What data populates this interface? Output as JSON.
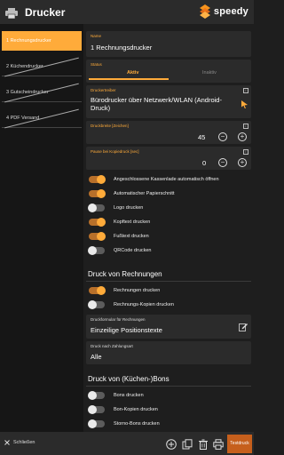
{
  "header": {
    "title": "Drucker",
    "brand": "speedy"
  },
  "sidebar": {
    "items": [
      {
        "label": "1 Rechnungsdrucker"
      },
      {
        "label": "2 Küchendrucker"
      },
      {
        "label": "3 Gutscheindrucker"
      },
      {
        "label": "4 PDF Versand"
      }
    ]
  },
  "form": {
    "name": {
      "label": "Name",
      "value": "1 Rechnungsdrucker"
    },
    "status": {
      "label": "Status",
      "active": "Aktiv",
      "inactive": "Inaktiv"
    },
    "driver": {
      "label": "Druckertreiber",
      "value": "Bürodrucker über Netzwerk/WLAN (Android-Druck)"
    },
    "width": {
      "label": "Druckbreite [Zeichen]",
      "value": "45"
    },
    "pause": {
      "label": "Pause bei Kopiedruck [sec]",
      "value": "0"
    },
    "toggles": [
      {
        "label": "Angeschlossene Kassenlade automatisch öffnen",
        "on": true
      },
      {
        "label": "Automatischer Papierschnitt",
        "on": true
      },
      {
        "label": "Logo drucken",
        "on": false
      },
      {
        "label": "Kopftext drucken",
        "on": true
      },
      {
        "label": "Fußtext drucken",
        "on": true
      },
      {
        "label": "QRCode drucken",
        "on": false
      }
    ],
    "invoice_section": "Druck von Rechnungen",
    "invoice_toggles": [
      {
        "label": "Rechnungen drucken",
        "on": true
      },
      {
        "label": "Rechnungs-Kopien drucken",
        "on": false
      }
    ],
    "invoice_format": {
      "label": "Druckformular für Rechnungen",
      "value": "Einzeilige Positionstexte"
    },
    "payment_print": {
      "label": "Druck nach Zahlungsart",
      "value": "Alle"
    },
    "bons_section": "Druck von (Küchen-)Bons",
    "bons_toggles": [
      {
        "label": "Bons drucken",
        "on": false
      },
      {
        "label": "Bon-Kopien drucken",
        "on": false
      },
      {
        "label": "Storno-Bons drucken",
        "on": false
      }
    ]
  },
  "footer": {
    "close_label": "Schließen",
    "test_label": "Testdruck"
  },
  "colors": {
    "accent": "#ffab3a",
    "panel": "#2b2b2b",
    "background": "#1e1e1e"
  }
}
